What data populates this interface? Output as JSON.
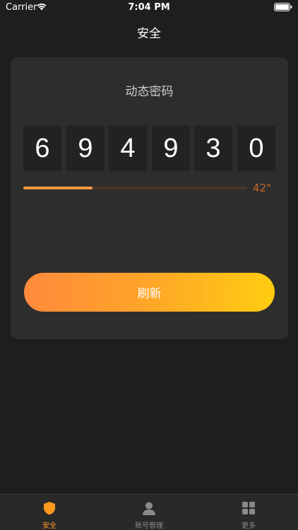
{
  "status_bar": {
    "carrier": "Carrier",
    "time": "7:04 PM"
  },
  "nav": {
    "title": "安全"
  },
  "card": {
    "title": "动态密码",
    "digits": [
      "6",
      "9",
      "4",
      "9",
      "3",
      "0"
    ],
    "progress": 0.31,
    "countdown": "42\"",
    "refresh_label": "刷新"
  },
  "tabs": [
    {
      "label": "安全",
      "icon": "shield-icon",
      "active": true
    },
    {
      "label": "账号管理",
      "icon": "person-icon",
      "active": false
    },
    {
      "label": "更多",
      "icon": "grid-icon",
      "active": false
    }
  ],
  "colors": {
    "accent": "#ff9a1f",
    "background": "#1f1e1e",
    "card": "#2e2d2d",
    "progress_fill": "#ff9a3d",
    "countdown": "#c46a2e"
  }
}
